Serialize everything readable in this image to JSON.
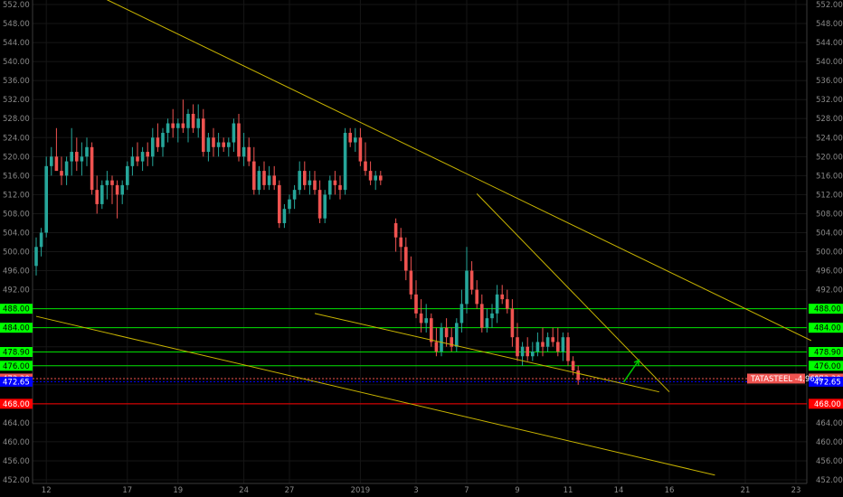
{
  "chart_data": {
    "type": "candlestick",
    "symbol": "TATASTEEL",
    "change": "-4.96%",
    "colors": {
      "up": "#26a69a",
      "down": "#ef5350",
      "trendline": "#c8b400",
      "support_green": "#00e000",
      "current_price": "#ef5350",
      "blue_level": "#0000ff",
      "red_level": "#ff0000",
      "arrow": "#00c800"
    },
    "y_axis": {
      "ylim": [
        452,
        552
      ],
      "ticks": [
        "552.00",
        "548.00",
        "544.00",
        "540.00",
        "536.00",
        "532.00",
        "528.00",
        "524.00",
        "520.00",
        "516.00",
        "512.00",
        "508.00",
        "504.00",
        "500.00",
        "496.00",
        "492.00",
        "488.00",
        "484.00",
        "480.00",
        "476.00",
        "472.00",
        "468.00",
        "464.00",
        "460.00",
        "456.00",
        "452.00"
      ]
    },
    "x_axis": {
      "labels": [
        {
          "text": "12",
          "bar": 2
        },
        {
          "text": "17",
          "bar": 18
        },
        {
          "text": "19",
          "bar": 28
        },
        {
          "text": "24",
          "bar": 41
        },
        {
          "text": "27",
          "bar": 50
        },
        {
          "text": "2019",
          "bar": 64
        },
        {
          "text": "3",
          "bar": 75
        },
        {
          "text": "7",
          "bar": 85
        },
        {
          "text": "9",
          "bar": 95
        },
        {
          "text": "11",
          "bar": 105
        },
        {
          "text": "14",
          "bar": 115
        },
        {
          "text": "16",
          "bar": 125
        },
        {
          "text": "21",
          "bar": 140
        },
        {
          "text": "23",
          "bar": 150
        }
      ],
      "bar_range": [
        0,
        153
      ]
    },
    "levels": [
      {
        "value": 488.0,
        "label": "488.00",
        "kind": "support_green"
      },
      {
        "value": 484.0,
        "label": "484.00",
        "kind": "support_green"
      },
      {
        "value": 478.9,
        "label": "478.90",
        "kind": "support_green"
      },
      {
        "value": 476.0,
        "label": "476.00",
        "kind": "support_green"
      },
      {
        "value": 473.3,
        "label": "473.30",
        "kind": "current_price"
      },
      {
        "value": 472.65,
        "label": "472.65",
        "kind": "blue_level"
      },
      {
        "value": 468.0,
        "label": "468.00",
        "kind": "red_level"
      }
    ],
    "trendlines": [
      {
        "x1": 14,
        "y1": 553,
        "x2": 153,
        "y2": 481.3
      },
      {
        "x1": 0,
        "y1": 486.4,
        "x2": 134,
        "y2": 453
      },
      {
        "x1": 55,
        "y1": 487,
        "x2": 123,
        "y2": 470.5
      },
      {
        "x1": 87,
        "y1": 512.2,
        "x2": 125,
        "y2": 470.5
      }
    ],
    "arrow": {
      "x1": 116,
      "y1": 472.6,
      "x2": 119,
      "y2": 477.2
    },
    "candles": [
      [
        497,
        503,
        495,
        501
      ],
      [
        501,
        505,
        499,
        504
      ],
      [
        504,
        520,
        503,
        518
      ],
      [
        518,
        522,
        516,
        520
      ],
      [
        520,
        526,
        518,
        517
      ],
      [
        517,
        520,
        514,
        516
      ],
      [
        516,
        520,
        514,
        519
      ],
      [
        519,
        526,
        516,
        521
      ],
      [
        521,
        524,
        517,
        519
      ],
      [
        519,
        523,
        516,
        520
      ],
      [
        520,
        524,
        518,
        522
      ],
      [
        522,
        523,
        512,
        513
      ],
      [
        513,
        516,
        508,
        510
      ],
      [
        510,
        515,
        509,
        514
      ],
      [
        514,
        517,
        511,
        515
      ],
      [
        515,
        516,
        510,
        514
      ],
      [
        514,
        515,
        507,
        512
      ],
      [
        512,
        515,
        510,
        514
      ],
      [
        514,
        519,
        513,
        518
      ],
      [
        518,
        522,
        516,
        520
      ],
      [
        520,
        523,
        518,
        519
      ],
      [
        519,
        522,
        517,
        521
      ],
      [
        521,
        523,
        518,
        520
      ],
      [
        520,
        526,
        518,
        524
      ],
      [
        524,
        527,
        521,
        522
      ],
      [
        522,
        526,
        520,
        525
      ],
      [
        525,
        528,
        523,
        527
      ],
      [
        527,
        530,
        524,
        526
      ],
      [
        526,
        528,
        523,
        527
      ],
      [
        527,
        532,
        525,
        526
      ],
      [
        526,
        530,
        523,
        529
      ],
      [
        529,
        531,
        525,
        526
      ],
      [
        526,
        531,
        524,
        528
      ],
      [
        528,
        530,
        520,
        521
      ],
      [
        521,
        525,
        519,
        524
      ],
      [
        524,
        526,
        520,
        522
      ],
      [
        522,
        525,
        520,
        523
      ],
      [
        523,
        524,
        521,
        522
      ],
      [
        522,
        524,
        520,
        523
      ],
      [
        523,
        528,
        521,
        527
      ],
      [
        527,
        529,
        519,
        520
      ],
      [
        520,
        525,
        518,
        522
      ],
      [
        522,
        524,
        518,
        519
      ],
      [
        519,
        522,
        512,
        513
      ],
      [
        513,
        518,
        512,
        517
      ],
      [
        517,
        519,
        513,
        514
      ],
      [
        514,
        518,
        513,
        516
      ],
      [
        516,
        518,
        513,
        514
      ],
      [
        514,
        515,
        505,
        506
      ],
      [
        506,
        510,
        505,
        509
      ],
      [
        509,
        512,
        508,
        511
      ],
      [
        511,
        514,
        509,
        513
      ],
      [
        513,
        519,
        512,
        517
      ],
      [
        517,
        519,
        513,
        514
      ],
      [
        514,
        517,
        512,
        515
      ],
      [
        515,
        517,
        512,
        513
      ],
      [
        513,
        515,
        506,
        507
      ],
      [
        507,
        513,
        506,
        512
      ],
      [
        512,
        516,
        511,
        515
      ],
      [
        515,
        517,
        512,
        514
      ],
      [
        514,
        516,
        511,
        513
      ],
      [
        513,
        526,
        512,
        525
      ],
      [
        525,
        526,
        522,
        523
      ],
      [
        523,
        526,
        521,
        524
      ],
      [
        524,
        526,
        518,
        519
      ],
      [
        519,
        523,
        516,
        517
      ],
      [
        517,
        519,
        514,
        515
      ],
      [
        515,
        517,
        513,
        516
      ],
      [
        516,
        517,
        514,
        515
      ],
      [
        506,
        507,
        500,
        503
      ],
      [
        503,
        505,
        498,
        501
      ],
      [
        501,
        503,
        494,
        496
      ],
      [
        496,
        499,
        490,
        491
      ],
      [
        491,
        494,
        486,
        487
      ],
      [
        487,
        490,
        483,
        485
      ],
      [
        485,
        489,
        483,
        486
      ],
      [
        486,
        487,
        480,
        481
      ],
      [
        481,
        484,
        478,
        479
      ],
      [
        479,
        485,
        478,
        484
      ],
      [
        484,
        486,
        480,
        482
      ],
      [
        482,
        484,
        479,
        480
      ],
      [
        480,
        486,
        479,
        485
      ],
      [
        485,
        492,
        483,
        489
      ],
      [
        489,
        501,
        487,
        496
      ],
      [
        496,
        498,
        491,
        492
      ],
      [
        492,
        494,
        488,
        489
      ],
      [
        489,
        491,
        483,
        484
      ],
      [
        484,
        488,
        483,
        486
      ],
      [
        486,
        489,
        484,
        487
      ],
      [
        487,
        493,
        485,
        491
      ],
      [
        491,
        493,
        489,
        490
      ],
      [
        490,
        492,
        487,
        488
      ],
      [
        488,
        490,
        480,
        482
      ],
      [
        482,
        485,
        477,
        478
      ],
      [
        478,
        481,
        476,
        480
      ],
      [
        480,
        482,
        477,
        478
      ],
      [
        478,
        481,
        477,
        479
      ],
      [
        479,
        483,
        478,
        481
      ],
      [
        481,
        484,
        478,
        480
      ],
      [
        480,
        483,
        479,
        482
      ],
      [
        482,
        484,
        480,
        481
      ],
      [
        481,
        484,
        478,
        479
      ],
      [
        479,
        483,
        477,
        482
      ],
      [
        482,
        483,
        476,
        477
      ],
      [
        477,
        478,
        474,
        475
      ],
      [
        475,
        476,
        472,
        473
      ]
    ],
    "candle_start_bars": [
      0,
      71
    ]
  }
}
